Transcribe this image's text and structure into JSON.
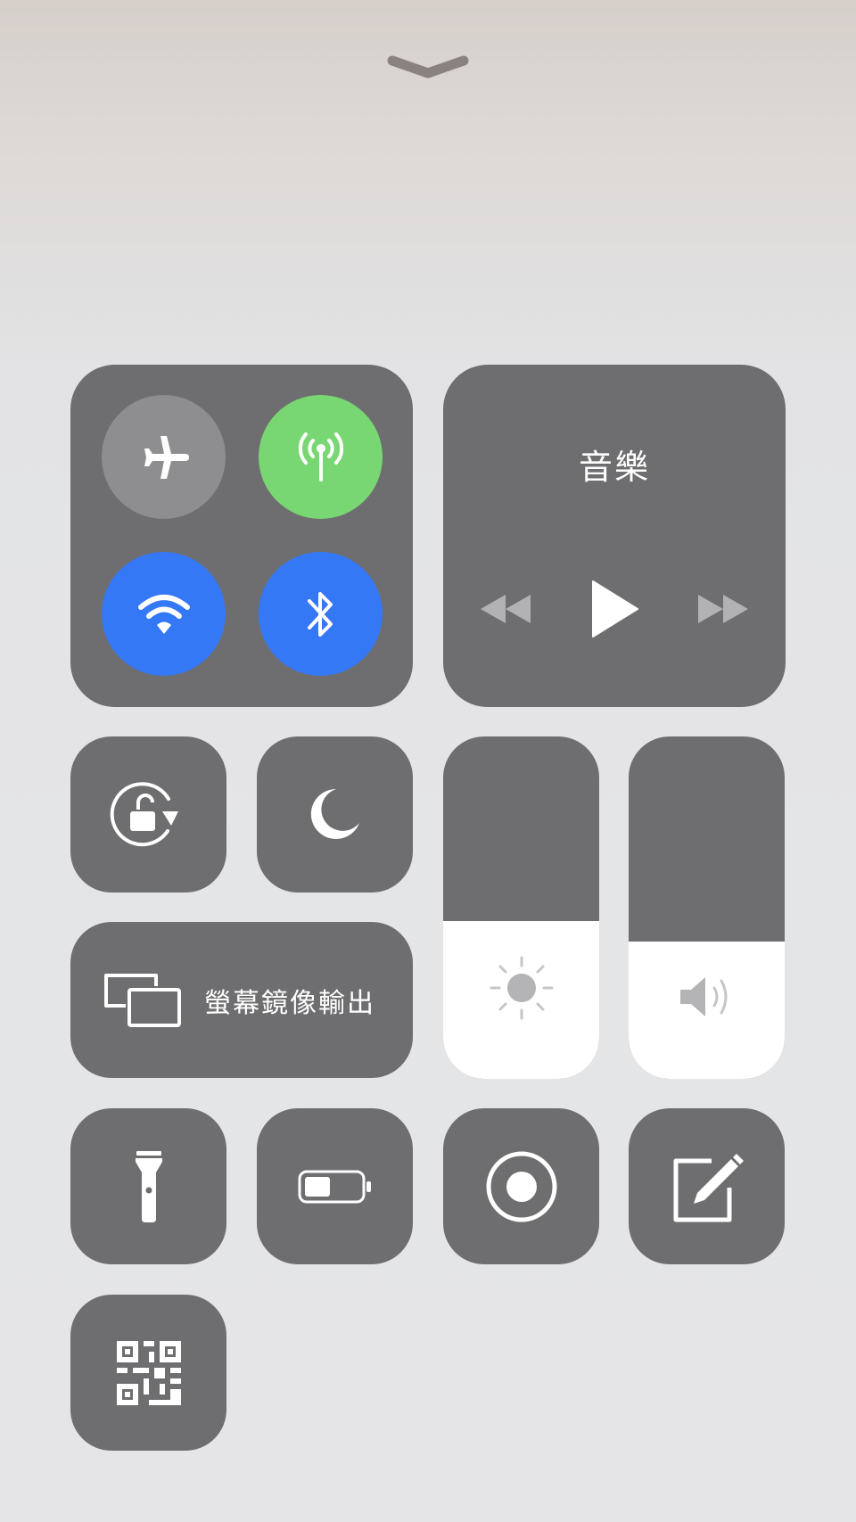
{
  "control_center": {
    "music": {
      "title": "音樂"
    },
    "screen_mirroring": {
      "label": "螢幕鏡像輸出"
    },
    "brightness_level": 0.46,
    "volume_level": 0.4,
    "toggles": {
      "airplane_mode": false,
      "cellular_data": true,
      "wifi": true,
      "bluetooth": true
    },
    "colors": {
      "tile": "#6e6e70",
      "airplane_off": "#8e8e90",
      "cellular_on": "#78d772",
      "wifi_on": "#3478f6",
      "bluetooth_on": "#3478f6"
    }
  }
}
